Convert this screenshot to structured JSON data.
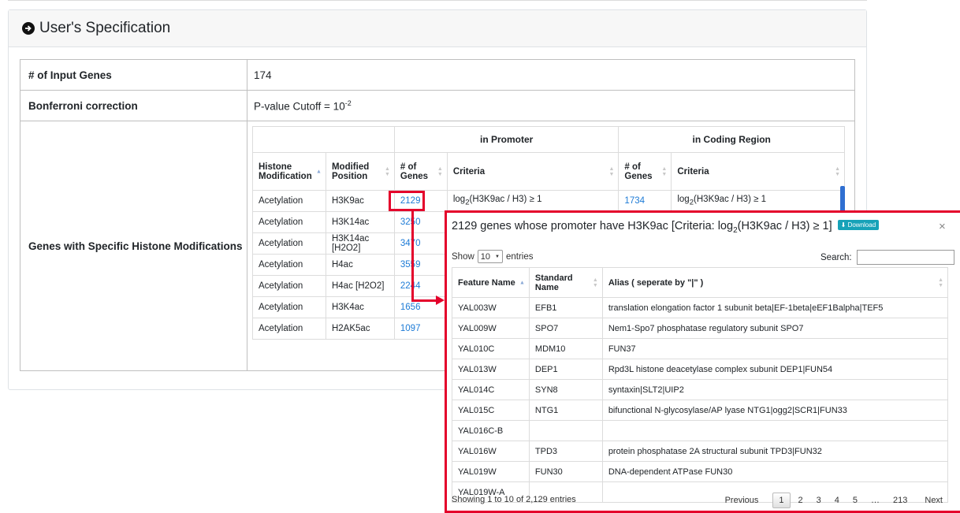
{
  "card": {
    "title": "User's Specification",
    "icon": "circle-arrow-right-icon"
  },
  "spec": {
    "input_genes_label": "# of Input Genes",
    "input_genes_value": "174",
    "bonferroni_label": "Bonferroni correction",
    "bonferroni_prefix": "P-value Cutoff = 10",
    "bonferroni_exp": "-2",
    "histone_label": "Genes with Specific Histone Modifications"
  },
  "inner": {
    "group_promoter": "in Promoter",
    "group_coding": "in Coding Region",
    "headers": [
      "Histone Modification",
      "Modified Position",
      "# of Genes",
      "Criteria",
      "# of Genes",
      "Criteria"
    ],
    "rows": [
      {
        "mod": "Acetylation",
        "pos": "H3K9ac",
        "p_genes": "2129",
        "p_crit_pre": "log",
        "p_crit_sub": "2",
        "p_crit_post": "(H3K9ac / H3) ≥ 1",
        "c_genes": "1734",
        "c_crit_pre": "log",
        "c_crit_sub": "2",
        "c_crit_post": "(H3K9ac / H3) ≥ 1"
      },
      {
        "mod": "Acetylation",
        "pos": "H3K14ac",
        "p_genes": "3250"
      },
      {
        "mod": "Acetylation",
        "pos": "H3K14ac [H2O2]",
        "p_genes": "3470"
      },
      {
        "mod": "Acetylation",
        "pos": "H4ac",
        "p_genes": "3559"
      },
      {
        "mod": "Acetylation",
        "pos": "H4ac [H2O2]",
        "p_genes": "2244"
      },
      {
        "mod": "Acetylation",
        "pos": "H3K4ac",
        "p_genes": "1656"
      },
      {
        "mod": "Acetylation",
        "pos": "H2AK5ac",
        "p_genes": "1097"
      }
    ]
  },
  "modal": {
    "title_pre": "2129 genes whose promoter have H3K9ac [Criteria: log",
    "title_sub": "2",
    "title_post": "(H3K9ac / H3) ≥ 1]",
    "download_label": "Download",
    "close": "×",
    "show_pre": "Show",
    "show_value": "10",
    "show_post": "entries",
    "search_label": "Search:",
    "headers": [
      "Feature Name",
      "Standard Name",
      "Alias ( seperate by \"|\" )"
    ],
    "rows": [
      {
        "feature": "YAL003W",
        "standard": "EFB1",
        "alias": "translation elongation factor 1 subunit beta|EF-1beta|eEF1Balpha|TEF5"
      },
      {
        "feature": "YAL009W",
        "standard": "SPO7",
        "alias": "Nem1-Spo7 phosphatase regulatory subunit SPO7"
      },
      {
        "feature": "YAL010C",
        "standard": "MDM10",
        "alias": "FUN37"
      },
      {
        "feature": "YAL013W",
        "standard": "DEP1",
        "alias": "Rpd3L histone deacetylase complex subunit DEP1|FUN54"
      },
      {
        "feature": "YAL014C",
        "standard": "SYN8",
        "alias": "syntaxin|SLT2|UIP2"
      },
      {
        "feature": "YAL015C",
        "standard": "NTG1",
        "alias": "bifunctional N-glycosylase/AP lyase NTG1|ogg2|SCR1|FUN33"
      },
      {
        "feature": "YAL016C-B",
        "standard": "",
        "alias": ""
      },
      {
        "feature": "YAL016W",
        "standard": "TPD3",
        "alias": "protein phosphatase 2A structural subunit TPD3|FUN32"
      },
      {
        "feature": "YAL019W",
        "standard": "FUN30",
        "alias": "DNA-dependent ATPase FUN30"
      },
      {
        "feature": "YAL019W-A",
        "standard": "",
        "alias": ""
      }
    ],
    "info": "Showing 1 to 10 of 2,129 entries",
    "pager": {
      "previous": "Previous",
      "pages": [
        "1",
        "2",
        "3",
        "4",
        "5",
        "…",
        "213"
      ],
      "next": "Next",
      "current": "1"
    }
  },
  "colors": {
    "link": "#1d7bd6",
    "highlight": "#e4002b",
    "download": "#17a2b8"
  }
}
